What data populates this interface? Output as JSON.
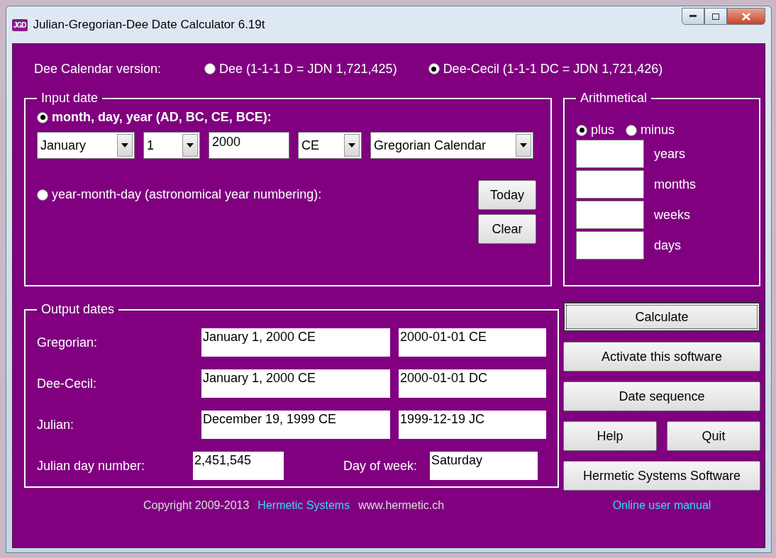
{
  "window": {
    "title": "Julian-Gregorian-Dee Date Calculator 6.19t",
    "app_icon": "JGD"
  },
  "calendar_version": {
    "label": "Dee Calendar version:",
    "options": [
      {
        "label": "Dee (1-1-1 D = JDN 1,721,425)",
        "selected": false
      },
      {
        "label": "Dee-Cecil (1-1-1 DC = JDN 1,721,426)",
        "selected": true
      }
    ]
  },
  "input_date": {
    "title": "Input date",
    "modes": [
      {
        "label": "month, day, year (AD, BC, CE, BCE):",
        "selected": true
      },
      {
        "label": "year-month-day (astronomical year numbering):",
        "selected": false
      }
    ],
    "fields": [
      {
        "kind": "dropdown",
        "value": "January"
      },
      {
        "kind": "dropdown",
        "value": "1"
      },
      {
        "kind": "text",
        "value": "2000"
      },
      {
        "kind": "dropdown",
        "value": "CE"
      },
      {
        "kind": "dropdown",
        "value": "Gregorian Calendar"
      }
    ],
    "buttons": [
      "Today",
      "Clear"
    ]
  },
  "arithmetical": {
    "title": "Arithmetical",
    "operations": [
      {
        "label": "plus",
        "selected": true
      },
      {
        "label": "minus",
        "selected": false
      }
    ],
    "fields": [
      {
        "label": "years"
      },
      {
        "label": "months"
      },
      {
        "label": "weeks"
      },
      {
        "label": "days"
      }
    ]
  },
  "output_dates": {
    "title": "Output dates",
    "rows": [
      {
        "label": "Gregorian:",
        "long": "January 1, 2000 CE",
        "iso": "2000-01-01 CE"
      },
      {
        "label": "Dee-Cecil:",
        "long": "January 1, 2000 CE",
        "iso": "2000-01-01 DC"
      },
      {
        "label": "Julian:",
        "long": "December 19, 1999 CE",
        "iso": "1999-12-19 JC"
      }
    ],
    "jdn": {
      "label": "Julian day number:",
      "value": "2,451,545"
    },
    "weekday": {
      "label": "Day of week:",
      "value": "Saturday"
    }
  },
  "buttons": [
    [
      {
        "label": "Calculate",
        "focused": true
      }
    ],
    [
      {
        "label": "Activate this software",
        "focused": false
      }
    ],
    [
      {
        "label": "Date sequence",
        "focused": false
      }
    ],
    [
      {
        "label": "Help",
        "focused": false
      },
      {
        "label": "Quit",
        "focused": false
      }
    ],
    [
      {
        "label": "Hermetic Systems Software",
        "focused": false
      }
    ]
  ],
  "footer": {
    "copyright": "Copyright 2009-2013",
    "company_link": "Hermetic Systems",
    "website": "www.hermetic.ch",
    "manual_link": "Online user manual"
  }
}
